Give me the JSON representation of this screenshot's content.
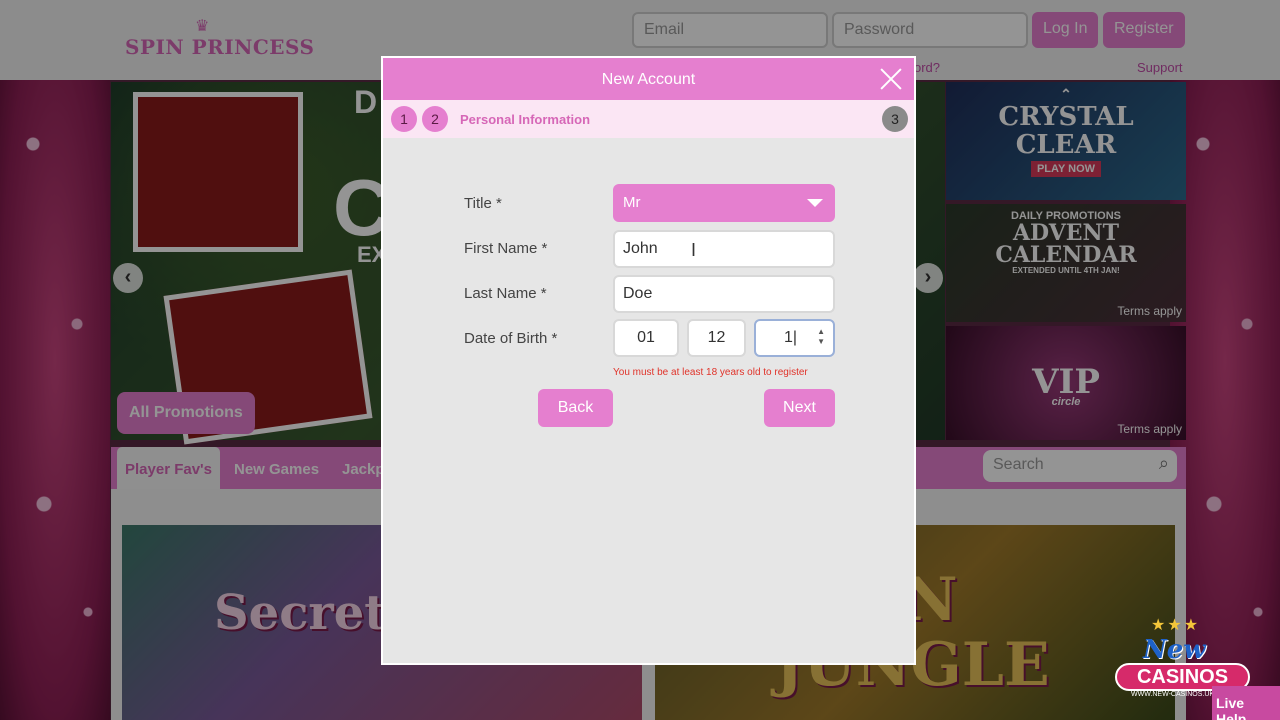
{
  "site": {
    "logo": "SPIN PRINCESS",
    "email_placeholder": "Email",
    "password_placeholder": "Password",
    "login_label": "Log In",
    "register_label": "Register",
    "forgot_link": "ord?",
    "support_link": "Support"
  },
  "hero": {
    "all_promotions_label": "All Promotions",
    "fragment_d": "D",
    "fragment_c": "C",
    "fragment_ex": "EX"
  },
  "promos": {
    "tile1": {
      "title1": "CRYSTAL",
      "title2": "CLEAR",
      "cta": "PLAY NOW"
    },
    "tile2": {
      "pre": "DAILY PROMOTIONS",
      "title1": "ADVENT",
      "title2": "CALENDAR",
      "sub": "EXTENDED UNTIL 4TH JAN!",
      "terms": "Terms apply"
    },
    "tile3": {
      "title": "VIP",
      "sub": "circle",
      "terms": "Terms apply"
    }
  },
  "tabs": [
    "Player Fav's",
    "New Games",
    "Jackp"
  ],
  "site_search_placeholder": "Search",
  "games": {
    "game1_title": "Secrets of Ch",
    "game2_title1": "DEN",
    "game2_title2": "JUNGLE"
  },
  "modal": {
    "title": "New Account",
    "steps": [
      "1",
      "2",
      "3"
    ],
    "current_step_label": "Personal Information",
    "form": {
      "title_label": "Title *",
      "title_value": "Mr",
      "first_name_label": "First Name *",
      "first_name_value": "John",
      "last_name_label": "Last Name *",
      "last_name_value": "Doe",
      "dob_label": "Date of Birth *",
      "dob_day": "01",
      "dob_month": "12",
      "dob_year": "1",
      "error": "You must be at least 18 years old to register"
    },
    "back_label": "Back",
    "next_label": "Next"
  },
  "watermark": {
    "new": "New",
    "casinos": "CASINOS",
    "url": "WWW.NEW-CASINOS.UK"
  },
  "live_help": "Live Help",
  "colors": {
    "accent": "#e57fcf",
    "error": "#e0332a",
    "modal_bg": "#e6e6e6"
  },
  "icons": [
    "close-icon",
    "chevron-down-icon",
    "spinner-arrows-icon",
    "search-icon",
    "arrow-left-icon",
    "arrow-right-icon"
  ]
}
